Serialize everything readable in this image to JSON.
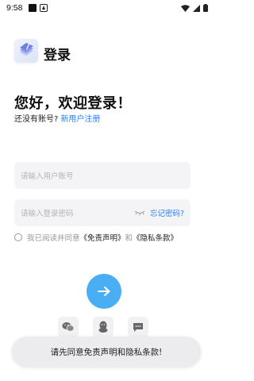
{
  "status_bar": {
    "time": "9:58"
  },
  "header": {
    "title": "登录"
  },
  "welcome": {
    "heading": "您好，欢迎登录！",
    "no_account": "还没有账号?",
    "register_link": "新用户注册"
  },
  "form": {
    "username_placeholder": "请输入用户账号",
    "password_placeholder": "请输入登录密码",
    "forgot_password": "忘记密码?"
  },
  "agreement": {
    "prefix": "我已阅读并同意",
    "disclaimer": "《免责声明》",
    "and": "和",
    "privacy": "《隐私条款》",
    "checked": false
  },
  "social": {
    "icons": [
      "wechat-icon",
      "qq-icon",
      "chat-icon"
    ]
  },
  "toast": {
    "message": "请先同意免责声明和隐私条款!"
  },
  "colors": {
    "accent": "#2f80ed",
    "button": "#4aaef5",
    "field_bg": "#f4f4f6"
  }
}
